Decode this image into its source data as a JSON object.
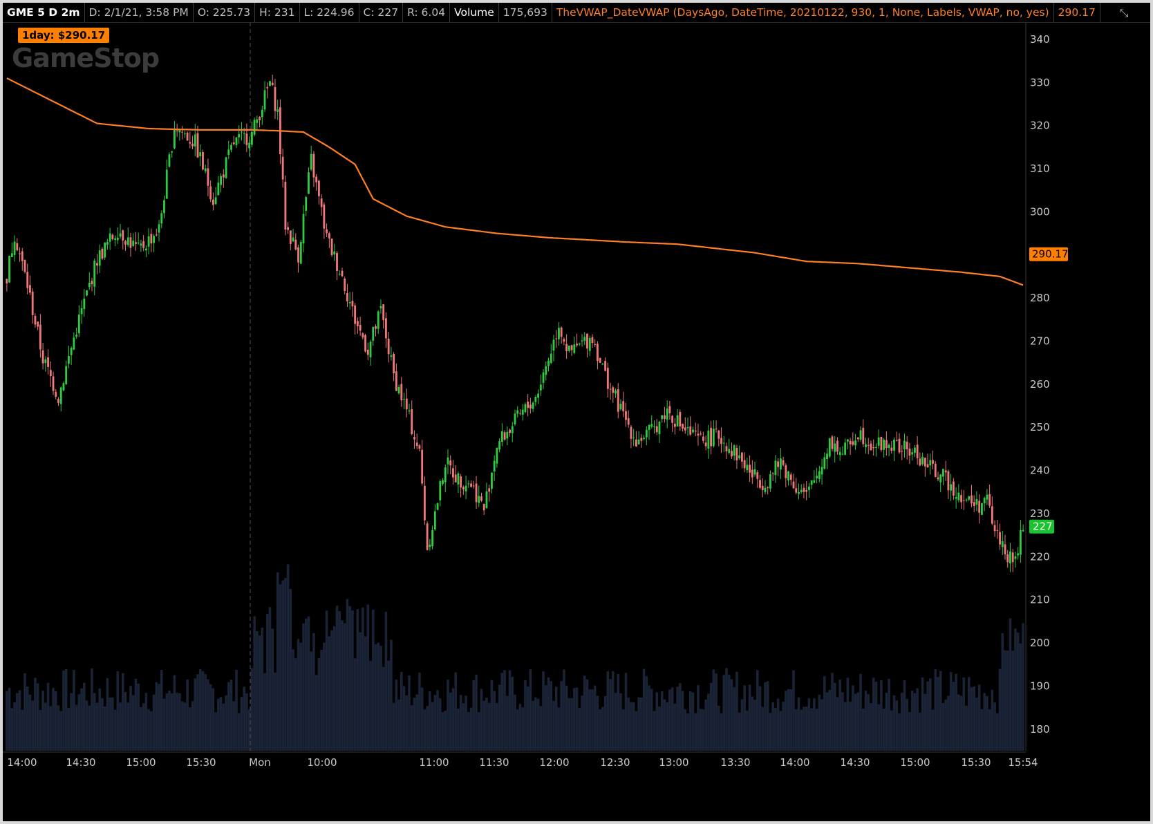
{
  "header": {
    "symbol": "GME 5 D 2m",
    "date": "D: 2/1/21, 3:58 PM",
    "open": "O: 225.73",
    "high": "H: 231",
    "low": "L: 224.96",
    "close": "C: 227",
    "range": "R: 6.04",
    "volume_label": "Volume",
    "volume_value": "175,693",
    "study": "TheVWAP_DateVWAP (DaysAgo, DateTime, 20210122, 930, 1, None, Labels, VWAP, no, yes)",
    "study_value": "290.17"
  },
  "badge": "1day: $290.17",
  "logo": "GameStop",
  "colors": {
    "up": "#2ecc40",
    "down": "#f07878",
    "vwap": "#ff7f24",
    "volume": "#1a2436",
    "last_price_bg": "#19c52f",
    "vwap_label_bg": "#ff8000"
  },
  "chart_data": {
    "type": "candlestick",
    "symbol": "GME",
    "ylim": [
      175,
      344
    ],
    "y_ticks": [
      180,
      190,
      200,
      210,
      220,
      230,
      240,
      250,
      260,
      270,
      280,
      290,
      300,
      310,
      320,
      330,
      340
    ],
    "x_ticks": [
      "14:00",
      "14:30",
      "15:00",
      "15:30",
      "Mon",
      "10:00",
      "11:00",
      "11:30",
      "12:00",
      "12:30",
      "13:00",
      "13:30",
      "14:00",
      "14:30",
      "15:00",
      "15:30",
      "15:54"
    ],
    "last_price": 227,
    "last_price_label": "227",
    "vwap_last": 290.17,
    "vwap_last_label": "290.17",
    "close_path": [
      [
        0,
        285
      ],
      [
        3,
        295
      ],
      [
        8,
        283
      ],
      [
        14,
        266
      ],
      [
        20,
        257
      ],
      [
        27,
        273
      ],
      [
        35,
        289
      ],
      [
        43,
        296
      ],
      [
        51,
        291
      ],
      [
        59,
        296
      ],
      [
        65,
        320
      ],
      [
        73,
        316
      ],
      [
        80,
        303
      ],
      [
        88,
        316
      ],
      [
        95,
        318
      ],
      [
        102,
        330
      ],
      [
        105,
        323
      ],
      [
        108,
        297
      ],
      [
        113,
        290
      ],
      [
        118,
        312
      ],
      [
        124,
        294
      ],
      [
        130,
        285
      ],
      [
        135,
        275
      ],
      [
        140,
        268
      ],
      [
        145,
        277
      ],
      [
        150,
        262
      ],
      [
        155,
        254
      ],
      [
        160,
        244
      ],
      [
        163,
        222
      ],
      [
        166,
        230
      ],
      [
        170,
        242
      ],
      [
        175,
        238
      ],
      [
        180,
        237
      ],
      [
        185,
        231
      ],
      [
        190,
        246
      ],
      [
        198,
        252
      ],
      [
        205,
        257
      ],
      [
        210,
        266
      ],
      [
        214,
        274
      ],
      [
        218,
        267
      ],
      [
        222,
        269
      ],
      [
        227,
        271
      ],
      [
        232,
        262
      ],
      [
        238,
        254
      ],
      [
        244,
        247
      ],
      [
        250,
        249
      ],
      [
        256,
        254
      ],
      [
        262,
        250
      ],
      [
        268,
        247
      ],
      [
        276,
        248
      ],
      [
        284,
        243
      ],
      [
        289,
        239
      ],
      [
        294,
        237
      ],
      [
        300,
        242
      ],
      [
        305,
        237
      ],
      [
        310,
        234
      ],
      [
        315,
        240
      ],
      [
        319,
        247
      ],
      [
        324,
        244
      ],
      [
        330,
        249
      ],
      [
        336,
        246
      ],
      [
        342,
        246
      ],
      [
        348,
        245
      ],
      [
        352,
        244
      ],
      [
        357,
        241
      ],
      [
        362,
        239
      ],
      [
        367,
        236
      ],
      [
        372,
        233
      ],
      [
        377,
        232
      ],
      [
        380,
        233
      ],
      [
        383,
        226
      ],
      [
        386,
        223
      ],
      [
        390,
        218
      ],
      [
        392,
        222
      ],
      [
        394,
        227
      ]
    ],
    "vwap_path": [
      [
        0,
        331
      ],
      [
        20,
        325
      ],
      [
        35,
        320.5
      ],
      [
        55,
        319.3
      ],
      [
        75,
        319.0
      ],
      [
        95,
        319.0
      ],
      [
        105,
        318.8
      ],
      [
        115,
        318.5
      ],
      [
        125,
        315
      ],
      [
        135,
        311
      ],
      [
        142,
        303
      ],
      [
        155,
        299
      ],
      [
        170,
        296.5
      ],
      [
        190,
        295
      ],
      [
        210,
        294
      ],
      [
        240,
        293
      ],
      [
        260,
        292.5
      ],
      [
        290,
        290.5
      ],
      [
        310,
        288.5
      ],
      [
        330,
        288
      ],
      [
        350,
        287
      ],
      [
        370,
        286
      ],
      [
        385,
        285
      ],
      [
        394,
        283
      ]
    ],
    "volume_range": [
      0,
      1
    ]
  }
}
